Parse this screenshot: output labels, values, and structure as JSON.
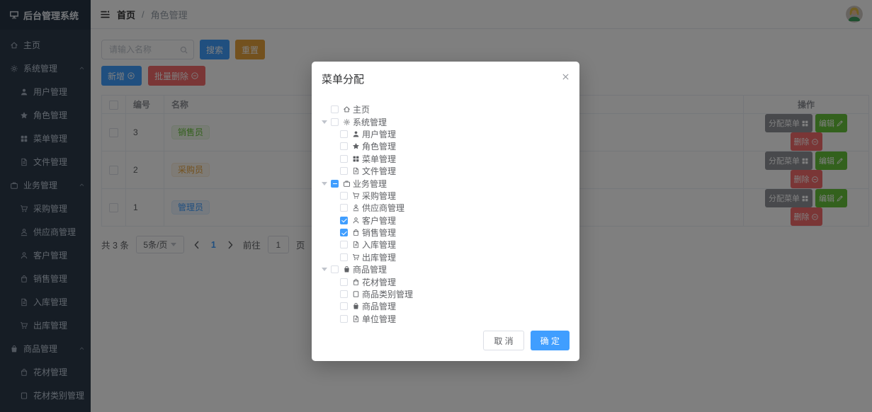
{
  "app": {
    "title": "后台管理系统",
    "logo_icon": "platform"
  },
  "sidebar": {
    "items": [
      {
        "label": "主页",
        "icon": "home",
        "level": 0,
        "group": false
      },
      {
        "label": "系统管理",
        "icon": "gear",
        "level": 0,
        "group": true
      },
      {
        "label": "用户管理",
        "icon": "user-solid",
        "level": 1,
        "group": false
      },
      {
        "label": "角色管理",
        "icon": "star",
        "level": 1,
        "group": false
      },
      {
        "label": "菜单管理",
        "icon": "grid",
        "level": 1,
        "group": false
      },
      {
        "label": "文件管理",
        "icon": "document",
        "level": 1,
        "group": false
      },
      {
        "label": "业务管理",
        "icon": "suitcase",
        "level": 0,
        "group": true
      },
      {
        "label": "采购管理",
        "icon": "cart",
        "level": 1,
        "group": false
      },
      {
        "label": "供应商管理",
        "icon": "user-base",
        "level": 1,
        "group": false
      },
      {
        "label": "客户管理",
        "icon": "user",
        "level": 1,
        "group": false
      },
      {
        "label": "销售管理",
        "icon": "bag",
        "level": 1,
        "group": false
      },
      {
        "label": "入库管理",
        "icon": "document",
        "level": 1,
        "group": false
      },
      {
        "label": "出库管理",
        "icon": "cart",
        "level": 1,
        "group": false
      },
      {
        "label": "商品管理",
        "icon": "goods",
        "level": 0,
        "group": true
      },
      {
        "label": "花材管理",
        "icon": "bag",
        "level": 1,
        "group": false
      },
      {
        "label": "花材类别管理",
        "icon": "square",
        "level": 1,
        "group": false
      }
    ]
  },
  "header": {
    "breadcrumb": {
      "root": "首页",
      "separator": "/",
      "current": "角色管理"
    }
  },
  "toolbar": {
    "search_placeholder": "请输入名称",
    "search_label": "搜索",
    "reset_label": "重置",
    "add_label": "新增",
    "batch_delete_label": "批量删除"
  },
  "table": {
    "columns": {
      "id": "编号",
      "name": "名称",
      "actions": "操作"
    },
    "rows": [
      {
        "id": "3",
        "name": "销售员",
        "tag": "success"
      },
      {
        "id": "2",
        "name": "采购员",
        "tag": "warning"
      },
      {
        "id": "1",
        "name": "管理员",
        "tag": "primary"
      }
    ],
    "actions": {
      "assign": "分配菜单",
      "edit": "编辑",
      "delete": "删除"
    }
  },
  "pagination": {
    "total": "共 3 条",
    "page_size": "5条/页",
    "current_page": "1",
    "goto_label": "前往",
    "goto_value": "1",
    "page_label": "页"
  },
  "modal": {
    "title": "菜单分配",
    "cancel_label": "取 消",
    "confirm_label": "确 定",
    "tree": [
      {
        "label": "主页",
        "icon": "home",
        "level": 0,
        "state": "unchecked",
        "expander": false
      },
      {
        "label": "系统管理",
        "icon": "gear",
        "level": 0,
        "state": "unchecked",
        "expander": true
      },
      {
        "label": "用户管理",
        "icon": "user-solid",
        "level": 1,
        "state": "unchecked",
        "expander": false
      },
      {
        "label": "角色管理",
        "icon": "star",
        "level": 1,
        "state": "unchecked",
        "expander": false
      },
      {
        "label": "菜单管理",
        "icon": "grid",
        "level": 1,
        "state": "unchecked",
        "expander": false
      },
      {
        "label": "文件管理",
        "icon": "document",
        "level": 1,
        "state": "unchecked",
        "expander": false
      },
      {
        "label": "业务管理",
        "icon": "suitcase",
        "level": 0,
        "state": "indeterminate",
        "expander": true
      },
      {
        "label": "采购管理",
        "icon": "cart",
        "level": 1,
        "state": "unchecked",
        "expander": false
      },
      {
        "label": "供应商管理",
        "icon": "user-base",
        "level": 1,
        "state": "unchecked",
        "expander": false
      },
      {
        "label": "客户管理",
        "icon": "user",
        "level": 1,
        "state": "checked",
        "expander": false
      },
      {
        "label": "销售管理",
        "icon": "bag",
        "level": 1,
        "state": "checked",
        "expander": false
      },
      {
        "label": "入库管理",
        "icon": "document",
        "level": 1,
        "state": "unchecked",
        "expander": false
      },
      {
        "label": "出库管理",
        "icon": "cart",
        "level": 1,
        "state": "unchecked",
        "expander": false
      },
      {
        "label": "商品管理",
        "icon": "goods",
        "level": 0,
        "state": "unchecked",
        "expander": true
      },
      {
        "label": "花材管理",
        "icon": "bag",
        "level": 1,
        "state": "unchecked",
        "expander": false
      },
      {
        "label": "商品类别管理",
        "icon": "square",
        "level": 1,
        "state": "unchecked",
        "expander": false
      },
      {
        "label": "商品管理",
        "icon": "goods",
        "level": 1,
        "state": "unchecked",
        "expander": false
      },
      {
        "label": "单位管理",
        "icon": "document",
        "level": 1,
        "state": "unchecked",
        "expander": false
      }
    ]
  },
  "colors": {
    "primary": "#409EFF",
    "success": "#67C23A",
    "warning": "#E6A23C",
    "danger": "#F56C6C",
    "info": "#909399",
    "sidebar_bg": "#2D3A4B",
    "mask": "rgba(0,0,0,0.5)"
  }
}
